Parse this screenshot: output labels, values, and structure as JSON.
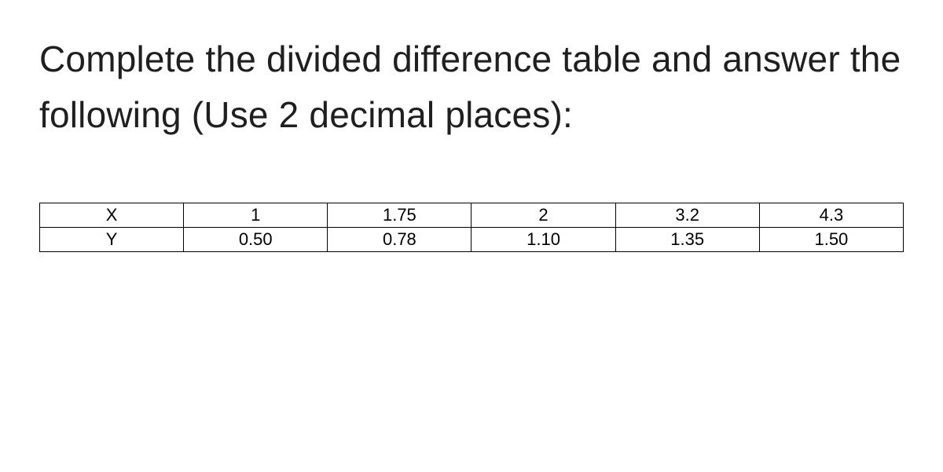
{
  "instruction": "Complete the divided difference table and answer the following (Use 2 decimal places):",
  "table": {
    "rows": [
      {
        "label": "X",
        "cells": [
          "1",
          "1.75",
          "2",
          "3.2",
          "4.3"
        ]
      },
      {
        "label": "Y",
        "cells": [
          "0.50",
          "0.78",
          "1.10",
          "1.35",
          "1.50"
        ]
      }
    ]
  }
}
